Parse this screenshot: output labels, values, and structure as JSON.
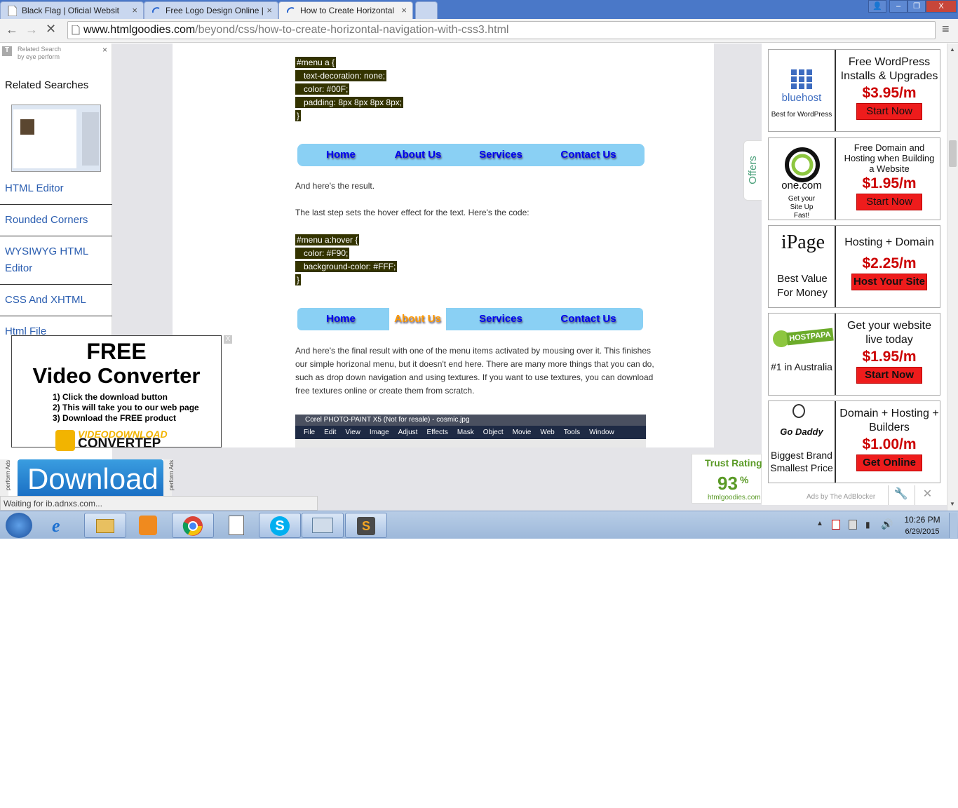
{
  "browser": {
    "tabs": [
      {
        "title": "Black Flag | Oficial Websit"
      },
      {
        "title": "Free Logo Design Online |"
      },
      {
        "title": "How to Create Horizontal"
      }
    ],
    "url_host": "www.htmlgoodies.com",
    "url_path": "/beyond/css/how-to-create-horizontal-navigation-with-css3.html"
  },
  "sidebar": {
    "top_title": "Related Search",
    "top_sub": "by eye perform",
    "heading": "Related Searches",
    "links": [
      "HTML Editor",
      "Rounded Corners",
      "WYSIWYG HTML Editor",
      "CSS And XHTML",
      "Html File"
    ]
  },
  "content": {
    "code1": [
      "#menu a {",
      "   text-decoration: none;",
      "   color: #00F;",
      "   padding: 8px 8px 8px 8px;",
      "}"
    ],
    "nav_items": [
      "Home",
      "About Us",
      "Services",
      "Contact Us"
    ],
    "result_text": "And here's the result.",
    "hover_intro": "The last step sets the hover effect for the text. Here's the code:",
    "code2": [
      "#menu a:hover {",
      "   color: #F90;",
      "   background-color: #FFF;",
      "}"
    ],
    "final_text": "And here's the final result with one of the menu items activated by mousing over it. This finishes our simple horizonal menu, but it doesn't end here. There are many more things that you can do, such as drop down navigation and using textures. If you want to use textures, you can download free textures online or create them from scratch.",
    "corel_title": "Corel PHOTO-PAINT X5 (Not for resale) - cosmic.jpg",
    "corel_menu": [
      "File",
      "Edit",
      "View",
      "Image",
      "Adjust",
      "Effects",
      "Mask",
      "Object",
      "Movie",
      "Web",
      "Tools",
      "Window"
    ]
  },
  "vc_ad": {
    "line1": "FREE",
    "line2": "Video Converter",
    "steps": [
      "1) Click the download button",
      "2) This will take you to our web page",
      "3) Download the FREE product"
    ],
    "brand_top": "VIDEODOWNLOAD",
    "brand_bottom": "CONVERTEP",
    "close": "X",
    "download_label": "Download",
    "side_label": "perform Ads"
  },
  "offers_tab": "Offers",
  "right_ads": [
    {
      "logo": "bluehost",
      "logo_sub": "Best for WordPress",
      "head": "Free WordPress Installs & Upgrades",
      "price": "$3.95/m",
      "button": "Start Now"
    },
    {
      "logo": "one.com",
      "logo_sub": "Get your Site Up Fast!",
      "head": "Free Domain and Hosting when Building a Website",
      "price": "$1.95/m",
      "button": "Start Now"
    },
    {
      "logo": "iPage",
      "logo_sub": "Best Value For Money",
      "head": "Hosting + Domain",
      "price": "$2.25/m",
      "button": "Host Your Site"
    },
    {
      "logo": "HOSTPAPA",
      "logo_sub": "#1 in Australia",
      "head": "Get your website live today",
      "price": "$1.95/m",
      "button": "Start Now"
    },
    {
      "logo": "Go Daddy",
      "logo_sub": "Biggest Brand Smallest Price",
      "head": "Domain + Hosting + Builders",
      "price": "$1.00/m",
      "button": "Get Online"
    }
  ],
  "ads_footer": "Ads by The AdBlocker",
  "trust": {
    "label": "Trust Rating",
    "value": "93",
    "unit": "%",
    "site": "htmlgoodies.com"
  },
  "status": "Waiting for ib.adnxs.com...",
  "clock": {
    "time": "10:26 PM",
    "date": "6/29/2015"
  }
}
